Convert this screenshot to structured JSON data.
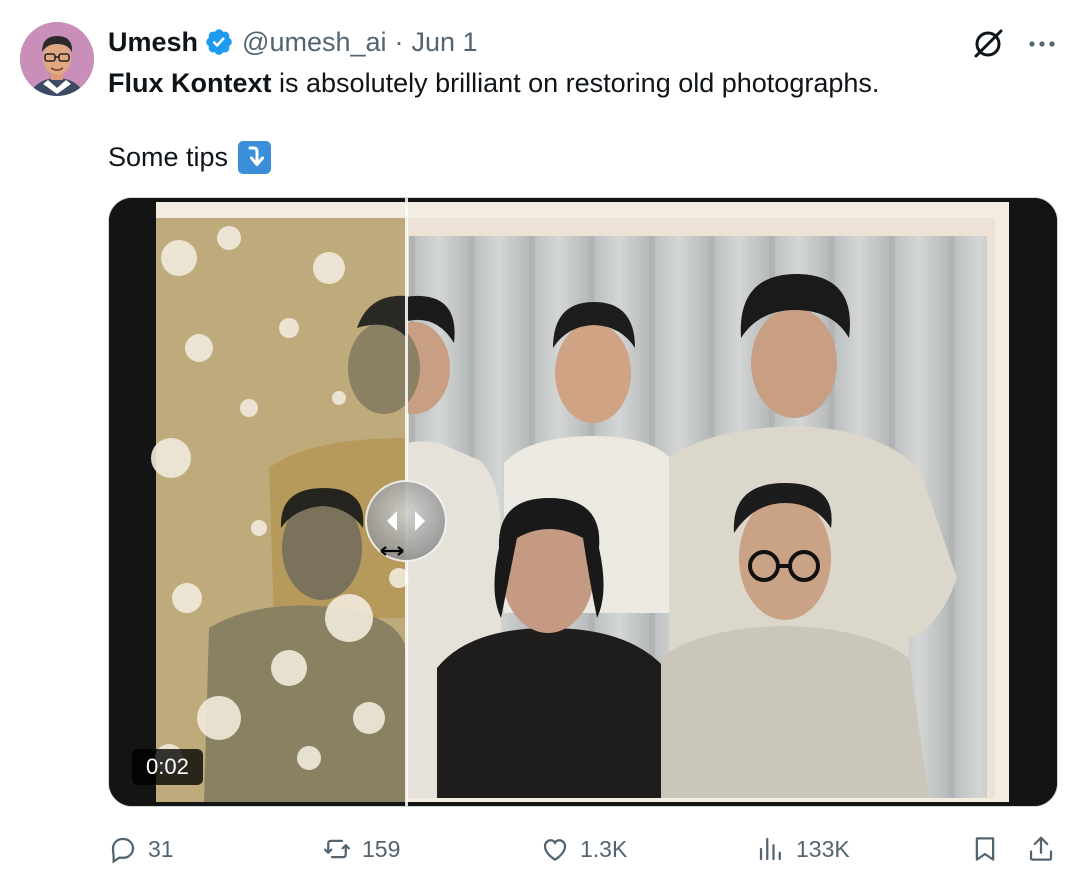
{
  "user": {
    "name": "Umesh",
    "handle": "@umesh_ai",
    "separator": "·",
    "date": "Jun 1",
    "verified": true,
    "avatar_bg": "#c98fb8"
  },
  "header_icons": [
    "grok-icon",
    "more-icon"
  ],
  "tweet": {
    "bold": "Flux Kontext",
    "rest": " is absolutely brilliant on restoring old photographs.",
    "line2": "Some tips",
    "emoji": "down-right-arrow-emoji"
  },
  "media": {
    "type": "video",
    "description_icon": "compare-slider-handle-icon",
    "timestamp": "0:02",
    "compare_position": 0.27
  },
  "actions": {
    "replies": "31",
    "retweets": "159",
    "likes": "1.3K",
    "views": "133K"
  },
  "colors": {
    "text": "#0f1419",
    "secondary": "#536471",
    "verified": "#1d9bf0",
    "emoji_bg": "#3b8fd9"
  }
}
